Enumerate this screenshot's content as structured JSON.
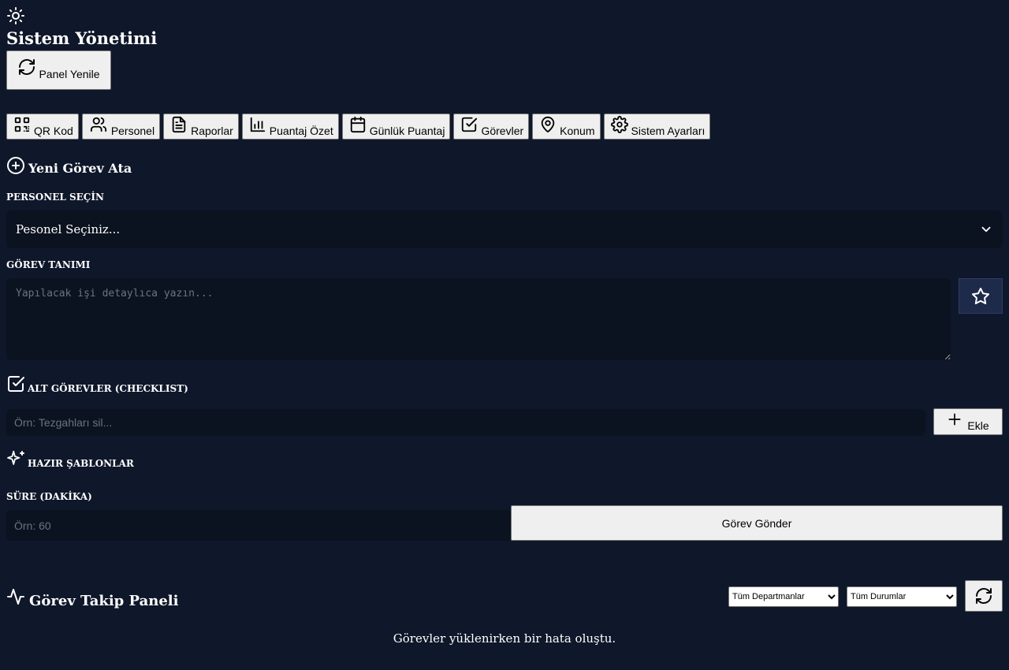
{
  "header": {
    "title": "Sistem Yönetimi",
    "refresh_label": "Panel Yenile"
  },
  "tabs": [
    {
      "label": "QR Kod",
      "icon": "qr-code-icon"
    },
    {
      "label": "Personel",
      "icon": "users-icon"
    },
    {
      "label": "Raporlar",
      "icon": "file-text-icon"
    },
    {
      "label": "Puantaj Özet",
      "icon": "bar-chart-icon"
    },
    {
      "label": "Günlük Puantaj",
      "icon": "calendar-icon"
    },
    {
      "label": "Görevler",
      "icon": "check-square-icon"
    },
    {
      "label": "Konum",
      "icon": "map-pin-icon"
    },
    {
      "label": "Sistem Ayarları",
      "icon": "settings-icon"
    }
  ],
  "form": {
    "heading": "Yeni Görev Ata",
    "personnel_label": "PERSONEL SEÇİN",
    "personnel_value": "Pesonel Seçiniz...",
    "task_label": "GÖREV TANIMI",
    "task_placeholder": "Yapılacak işi detaylıca yazın...",
    "subtasks_label": "ALT GÖREVLER (CHECKLIST)",
    "subtask_placeholder": "Örn: Tezgahları sil...",
    "add_label": "Ekle",
    "templates_label": "HAZIR ŞABLONLAR",
    "duration_label": "SÜRE (DAKİKA)",
    "duration_placeholder": "Örn: 60",
    "send_label": "Görev Gönder"
  },
  "panel": {
    "heading": "Görev Takip Paneli",
    "department_filter": "Tüm Departmanlar",
    "status_filter": "Tüm Durumlar",
    "error_message": "Görevler yüklenirken bir hata oluştu."
  },
  "colors": {
    "background": "#0f172a",
    "input_bg": "#0b1220",
    "star_button_bg": "#1e2a4a"
  }
}
